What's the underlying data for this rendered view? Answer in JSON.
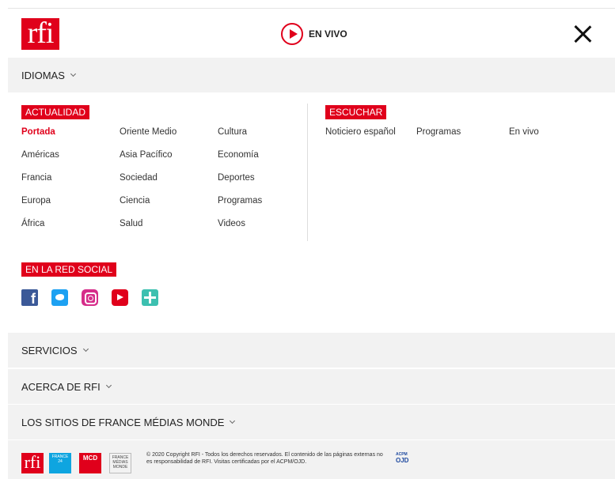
{
  "header": {
    "logo_text": "rfi",
    "live_label": "EN VIVO"
  },
  "idiomas": {
    "label": "IDIOMAS"
  },
  "actualidad": {
    "title": "ACTUALIDAD",
    "columns": [
      [
        "Portada",
        "Américas",
        "Francia",
        "Europa",
        "África"
      ],
      [
        "Oriente Medio",
        "Asia Pacífico",
        "Sociedad",
        "Ciencia",
        "Salud"
      ],
      [
        "Cultura",
        "Economía",
        "Deportes",
        "Programas",
        "Videos"
      ]
    ]
  },
  "escuchar": {
    "title": "ESCUCHAR",
    "items": [
      "Noticiero español",
      "Programas",
      "En vivo"
    ]
  },
  "social": {
    "title": "EN LA RED SOCIAL",
    "icons": [
      "facebook-icon",
      "twitter-icon",
      "instagram-icon",
      "youtube-icon",
      "podcast-icon"
    ]
  },
  "bars": {
    "servicios": "SERVICIOS",
    "acerca": "ACERCA DE RFI",
    "sitios": "LOS SITIOS DE FRANCE MÉDIAS MONDE"
  },
  "footer": {
    "logo_rfi": "rfi",
    "logo_f24": "FRANCE 24",
    "logo_mcd": "MCD",
    "logo_fmm": "FRANCE MÉDIAS MONDE",
    "copyright": "© 2020 Copyright RFI - Todos los derechos reservados. El contenido de las páginas externas no es responsabilidad de RFI. Visitas certificadas por el ACPM/OJD.",
    "ojd_top": "ACPM",
    "ojd": "OJD"
  },
  "colors": {
    "brand": "#e0001b",
    "bar": "#f2f2f2"
  }
}
